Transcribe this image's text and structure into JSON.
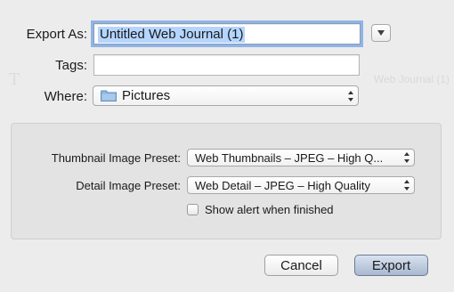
{
  "ghost_background": {
    "text": "Web Journal (1)"
  },
  "export_as": {
    "label": "Export As:",
    "value": "Untitled Web Journal (1)"
  },
  "tags": {
    "label": "Tags:",
    "value": ""
  },
  "where": {
    "label": "Where:",
    "selected": "Pictures",
    "icon": "folder-icon"
  },
  "presets": {
    "thumbnail_label": "Thumbnail Image Preset:",
    "thumbnail_selected": "Web Thumbnails – JPEG – High Q...",
    "detail_label": "Detail Image Preset:",
    "detail_selected": "Web Detail – JPEG – High Quality",
    "alert_label": "Show alert when finished",
    "alert_checked": false
  },
  "buttons": {
    "cancel": "Cancel",
    "export": "Export"
  }
}
